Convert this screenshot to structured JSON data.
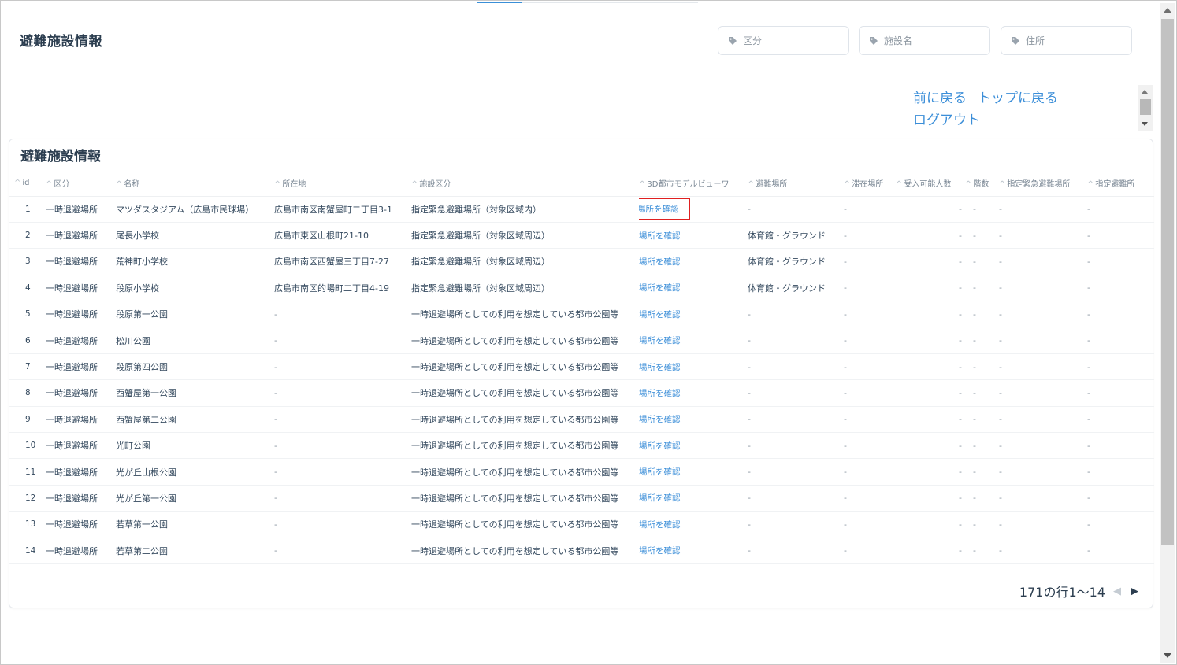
{
  "page": {
    "title": "避難施設情報"
  },
  "filters": [
    {
      "icon": "tag-icon",
      "label": "区分"
    },
    {
      "icon": "tag-icon",
      "label": "施設名"
    },
    {
      "icon": "tag-icon",
      "label": "住所"
    }
  ],
  "nav": {
    "back": "前に戻る",
    "top": "トップに戻る",
    "logout": "ログアウト"
  },
  "panel": {
    "title": "避難施設情報"
  },
  "table": {
    "columns": [
      "id",
      "区分",
      "名称",
      "所在地",
      "施設区分",
      "3D都市モデルビューワ",
      "避難場所",
      "滞在場所",
      "受入可能人数",
      "階数",
      "指定緊急避難場所",
      "指定避難所"
    ],
    "link_label": "場所を確認",
    "rows": [
      {
        "id": "1",
        "kubun": "一時退避場所",
        "name": "マツダスタジアム（広島市民球場）",
        "address": "広島市南区南蟹屋町二丁目3-1",
        "facility": "指定緊急避難場所（対象区域内）",
        "evac": "-",
        "stay": "-",
        "capacity": "-",
        "floors": "-",
        "emergency": "-",
        "shelter": "-"
      },
      {
        "id": "2",
        "kubun": "一時退避場所",
        "name": "尾長小学校",
        "address": "広島市東区山根町21-10",
        "facility": "指定緊急避難場所（対象区域周辺）",
        "evac": "体育館・グラウンド",
        "stay": "-",
        "capacity": "-",
        "floors": "-",
        "emergency": "-",
        "shelter": "-"
      },
      {
        "id": "3",
        "kubun": "一時退避場所",
        "name": "荒神町小学校",
        "address": "広島市南区西蟹屋三丁目7-27",
        "facility": "指定緊急避難場所（対象区域周辺）",
        "evac": "体育館・グラウンド",
        "stay": "-",
        "capacity": "-",
        "floors": "-",
        "emergency": "-",
        "shelter": "-"
      },
      {
        "id": "4",
        "kubun": "一時退避場所",
        "name": "段原小学校",
        "address": "広島市南区的場町二丁目4-19",
        "facility": "指定緊急避難場所（対象区域周辺）",
        "evac": "体育館・グラウンド",
        "stay": "-",
        "capacity": "-",
        "floors": "-",
        "emergency": "-",
        "shelter": "-"
      },
      {
        "id": "5",
        "kubun": "一時退避場所",
        "name": "段原第一公園",
        "address": "-",
        "facility": "一時退避場所としての利用を想定している都市公園等",
        "evac": "-",
        "stay": "-",
        "capacity": "-",
        "floors": "-",
        "emergency": "-",
        "shelter": "-"
      },
      {
        "id": "6",
        "kubun": "一時退避場所",
        "name": "松川公園",
        "address": "-",
        "facility": "一時退避場所としての利用を想定している都市公園等",
        "evac": "-",
        "stay": "-",
        "capacity": "-",
        "floors": "-",
        "emergency": "-",
        "shelter": "-"
      },
      {
        "id": "7",
        "kubun": "一時退避場所",
        "name": "段原第四公園",
        "address": "-",
        "facility": "一時退避場所としての利用を想定している都市公園等",
        "evac": "-",
        "stay": "-",
        "capacity": "-",
        "floors": "-",
        "emergency": "-",
        "shelter": "-"
      },
      {
        "id": "8",
        "kubun": "一時退避場所",
        "name": "西蟹屋第一公園",
        "address": "-",
        "facility": "一時退避場所としての利用を想定している都市公園等",
        "evac": "-",
        "stay": "-",
        "capacity": "-",
        "floors": "-",
        "emergency": "-",
        "shelter": "-"
      },
      {
        "id": "9",
        "kubun": "一時退避場所",
        "name": "西蟹屋第二公園",
        "address": "-",
        "facility": "一時退避場所としての利用を想定している都市公園等",
        "evac": "-",
        "stay": "-",
        "capacity": "-",
        "floors": "-",
        "emergency": "-",
        "shelter": "-"
      },
      {
        "id": "10",
        "kubun": "一時退避場所",
        "name": "光町公園",
        "address": "-",
        "facility": "一時退避場所としての利用を想定している都市公園等",
        "evac": "-",
        "stay": "-",
        "capacity": "-",
        "floors": "-",
        "emergency": "-",
        "shelter": "-"
      },
      {
        "id": "11",
        "kubun": "一時退避場所",
        "name": "光が丘山根公園",
        "address": "-",
        "facility": "一時退避場所としての利用を想定している都市公園等",
        "evac": "-",
        "stay": "-",
        "capacity": "-",
        "floors": "-",
        "emergency": "-",
        "shelter": "-"
      },
      {
        "id": "12",
        "kubun": "一時退避場所",
        "name": "光が丘第一公園",
        "address": "-",
        "facility": "一時退避場所としての利用を想定している都市公園等",
        "evac": "-",
        "stay": "-",
        "capacity": "-",
        "floors": "-",
        "emergency": "-",
        "shelter": "-"
      },
      {
        "id": "13",
        "kubun": "一時退避場所",
        "name": "若草第一公園",
        "address": "-",
        "facility": "一時退避場所としての利用を想定している都市公園等",
        "evac": "-",
        "stay": "-",
        "capacity": "-",
        "floors": "-",
        "emergency": "-",
        "shelter": "-"
      },
      {
        "id": "14",
        "kubun": "一時退避場所",
        "name": "若草第二公園",
        "address": "-",
        "facility": "一時退避場所としての利用を想定している都市公園等",
        "evac": "-",
        "stay": "-",
        "capacity": "-",
        "floors": "-",
        "emergency": "-",
        "shelter": "-"
      }
    ],
    "highlighted_row": "1"
  },
  "pagination": {
    "summary": "171の行1～14",
    "prev_icon": "chevron-left-icon",
    "next_icon": "chevron-right-icon"
  },
  "colors": {
    "link": "#3b8ed8",
    "highlight": "#e02020",
    "title": "#2c3e50"
  }
}
